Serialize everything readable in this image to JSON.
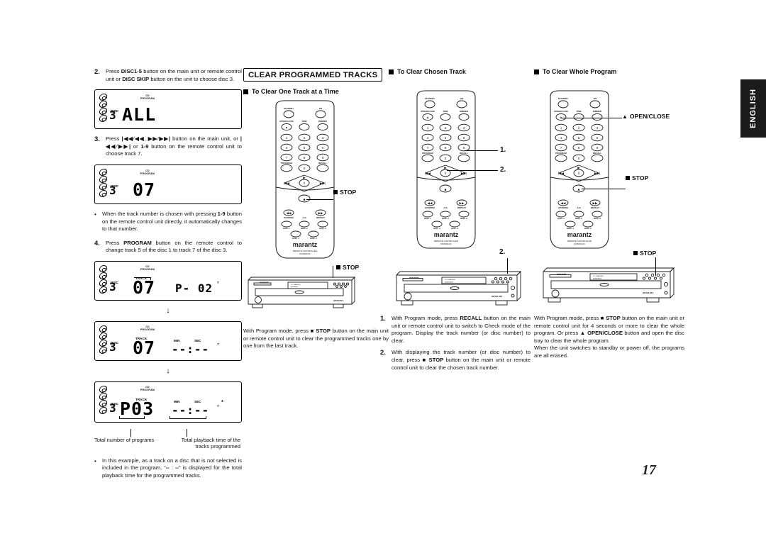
{
  "page": {
    "number": "17",
    "language_tab": "ENGLISH"
  },
  "column1": {
    "steps": [
      {
        "num": "2.",
        "text_parts": [
          "Press ",
          "DISC1-5",
          " button on the main unit or remote control unit or ",
          "DISC SKIP",
          " button on the unit to choose disc 3."
        ],
        "text": "Press DISC1-5 button on the main unit or remote control unit or DISC SKIP button on the unit to choose disc 3."
      },
      {
        "num": "3.",
        "text": "Press |◀◀/◀◀, ▶▶/▶▶| button on the main unit, or |◀◀/▶▶| or 1-9 button on the remote control unit to choose track 7."
      },
      {
        "num": "4.",
        "text": "Press PROGRAM button on the remote control to change track 5 of the disc 1 to track 7 of the disc 3."
      }
    ],
    "bullets": [
      "When the track number is chosen with pressing 1-9 button on the remote control unit directly, it automatically changes to that number.",
      "In this example, as a track on a disc that is not selected is included in the program, “-- : --” is displayed for the total playback time for the programmed tracks."
    ],
    "displays": [
      {
        "id": "display-all",
        "cd_label": "CD",
        "program_label": "PROGRAM",
        "disc_label": "DISC",
        "disc_value": "3",
        "main_value": "ALL",
        "track_label": "",
        "time_value": "",
        "extra": ""
      },
      {
        "id": "display-track07",
        "cd_label": "CD",
        "program_label": "PROGRAM",
        "disc_label": "DISC",
        "disc_value": "3",
        "main_value": "07",
        "track_label": "",
        "time_value": "",
        "extra": ""
      },
      {
        "id": "display-p02",
        "cd_label": "CD",
        "program_label": "PROGRAM",
        "disc_label": "DISC",
        "disc_value": "3",
        "main_value": "07",
        "track_label": "TRACK",
        "time_value": "P- 02",
        "extra": "7"
      },
      {
        "id": "display-blank-time",
        "cd_label": "CD",
        "program_label": "PROGRAM",
        "disc_label": "DISC",
        "disc_value": "3",
        "main_value": "07",
        "track_label": "TRACK",
        "min_label": "MIN",
        "sec_label": "SEC",
        "time_value": "--:--",
        "extra": "7"
      },
      {
        "id": "display-p03",
        "cd_label": "CD",
        "program_label": "PROGRAM",
        "disc_label": "DISC",
        "disc_value": "3",
        "main_value": "P03",
        "track_label": "TRACK",
        "min_label": "MIN",
        "sec_label": "SEC",
        "time_value": "--:--",
        "extra": "7",
        "extra2": "3"
      }
    ],
    "captions": {
      "left": "Total number of programs",
      "right": "Total playback time of the tracks programmed"
    },
    "arrow": "↓"
  },
  "column2": {
    "section_title": "CLEAR PROGRAMMED TRACKS",
    "sub_head": "To Clear One Track at a Time",
    "callout_remote": "STOP",
    "callout_unit": "STOP",
    "body": "With Program mode, press ■ STOP button on the main unit or remote control unit to clear the programmed tracks one by one from the last track."
  },
  "column3": {
    "sub_head": "To Clear Chosen Track",
    "callout_1": "1.",
    "callout_2": "2.",
    "callout_unit_2": "2.",
    "steps": [
      {
        "num": "1.",
        "text": "With Program mode, press RECALL button on the main unit or remote control unit to switch to Check mode of the program. Display the track number (or disc number) to clear."
      },
      {
        "num": "2.",
        "text": "With displaying the track number (or disc number) to clear, press ■ STOP button on the main unit or remote control unit to clear the chosen track number."
      }
    ]
  },
  "column4": {
    "sub_head": "To Clear Whole Program",
    "callout_open_close": "OPEN/CLOSE",
    "callout_stop": "STOP",
    "callout_unit_stop": "STOP",
    "body": "With Program mode, press ■ STOP button on the main unit or remote control unit for 4 seconds or more to clear the whole program. Or press ▲ OPEN/CLOSE button and open the disc tray to clear the whole program.\nWhen the unit switches to standby or power off, the programs are all erased."
  },
  "remote": {
    "brand": "marantz",
    "model_line1": "REMOTE CONTROLLER",
    "model_line2": "RC6001CD",
    "buttons": {
      "standby": "STANDBY",
      "on": "ON",
      "open_close": "OPEN/CLOSE",
      "time": "TIME",
      "dimmer": "DIMMER",
      "num1": "1",
      "num2": "2",
      "num3": "3",
      "num4": "4",
      "num5": "5",
      "num6": "6",
      "num7": "7",
      "num8": "8",
      "num9": "9",
      "num0": "0",
      "program": "PROGRAM",
      "recall": "RECALL",
      "play": "▶",
      "pause": "Ⅲ",
      "stop": "■",
      "prev": "◀◀",
      "next": "▶▶",
      "random": "RANDOM",
      "amode": "A-B",
      "repeat": "REPEAT",
      "disc1": "DISC 1",
      "disc2": "DISC 2",
      "disc3": "DISC 3",
      "disc4": "DISC 4",
      "disc5": "DISC 5"
    }
  },
  "cd_unit": {
    "brand": "marantz",
    "model": "CD CHANGER",
    "badge1": "HDAM",
    "badge2": "DF1"
  }
}
